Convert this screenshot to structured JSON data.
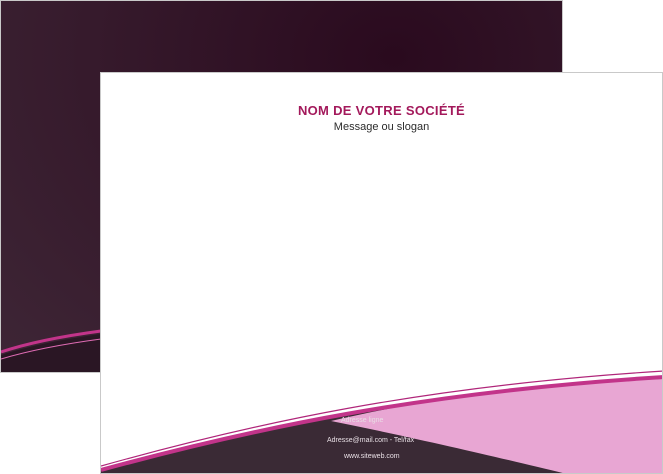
{
  "company": {
    "name": "NOM DE VOTRE SOCIÉTÉ",
    "slogan": "Message ou slogan"
  },
  "footer": {
    "address": "Adresse ligne",
    "contact": "Adresse@mail.com - Tel/fax",
    "website": "www.siteweb.com"
  },
  "colors": {
    "accent": "#a3195b",
    "wave_pink": "#c2348a",
    "wave_light": "#e8a6d3",
    "dark_plum": "#3a2a35"
  }
}
